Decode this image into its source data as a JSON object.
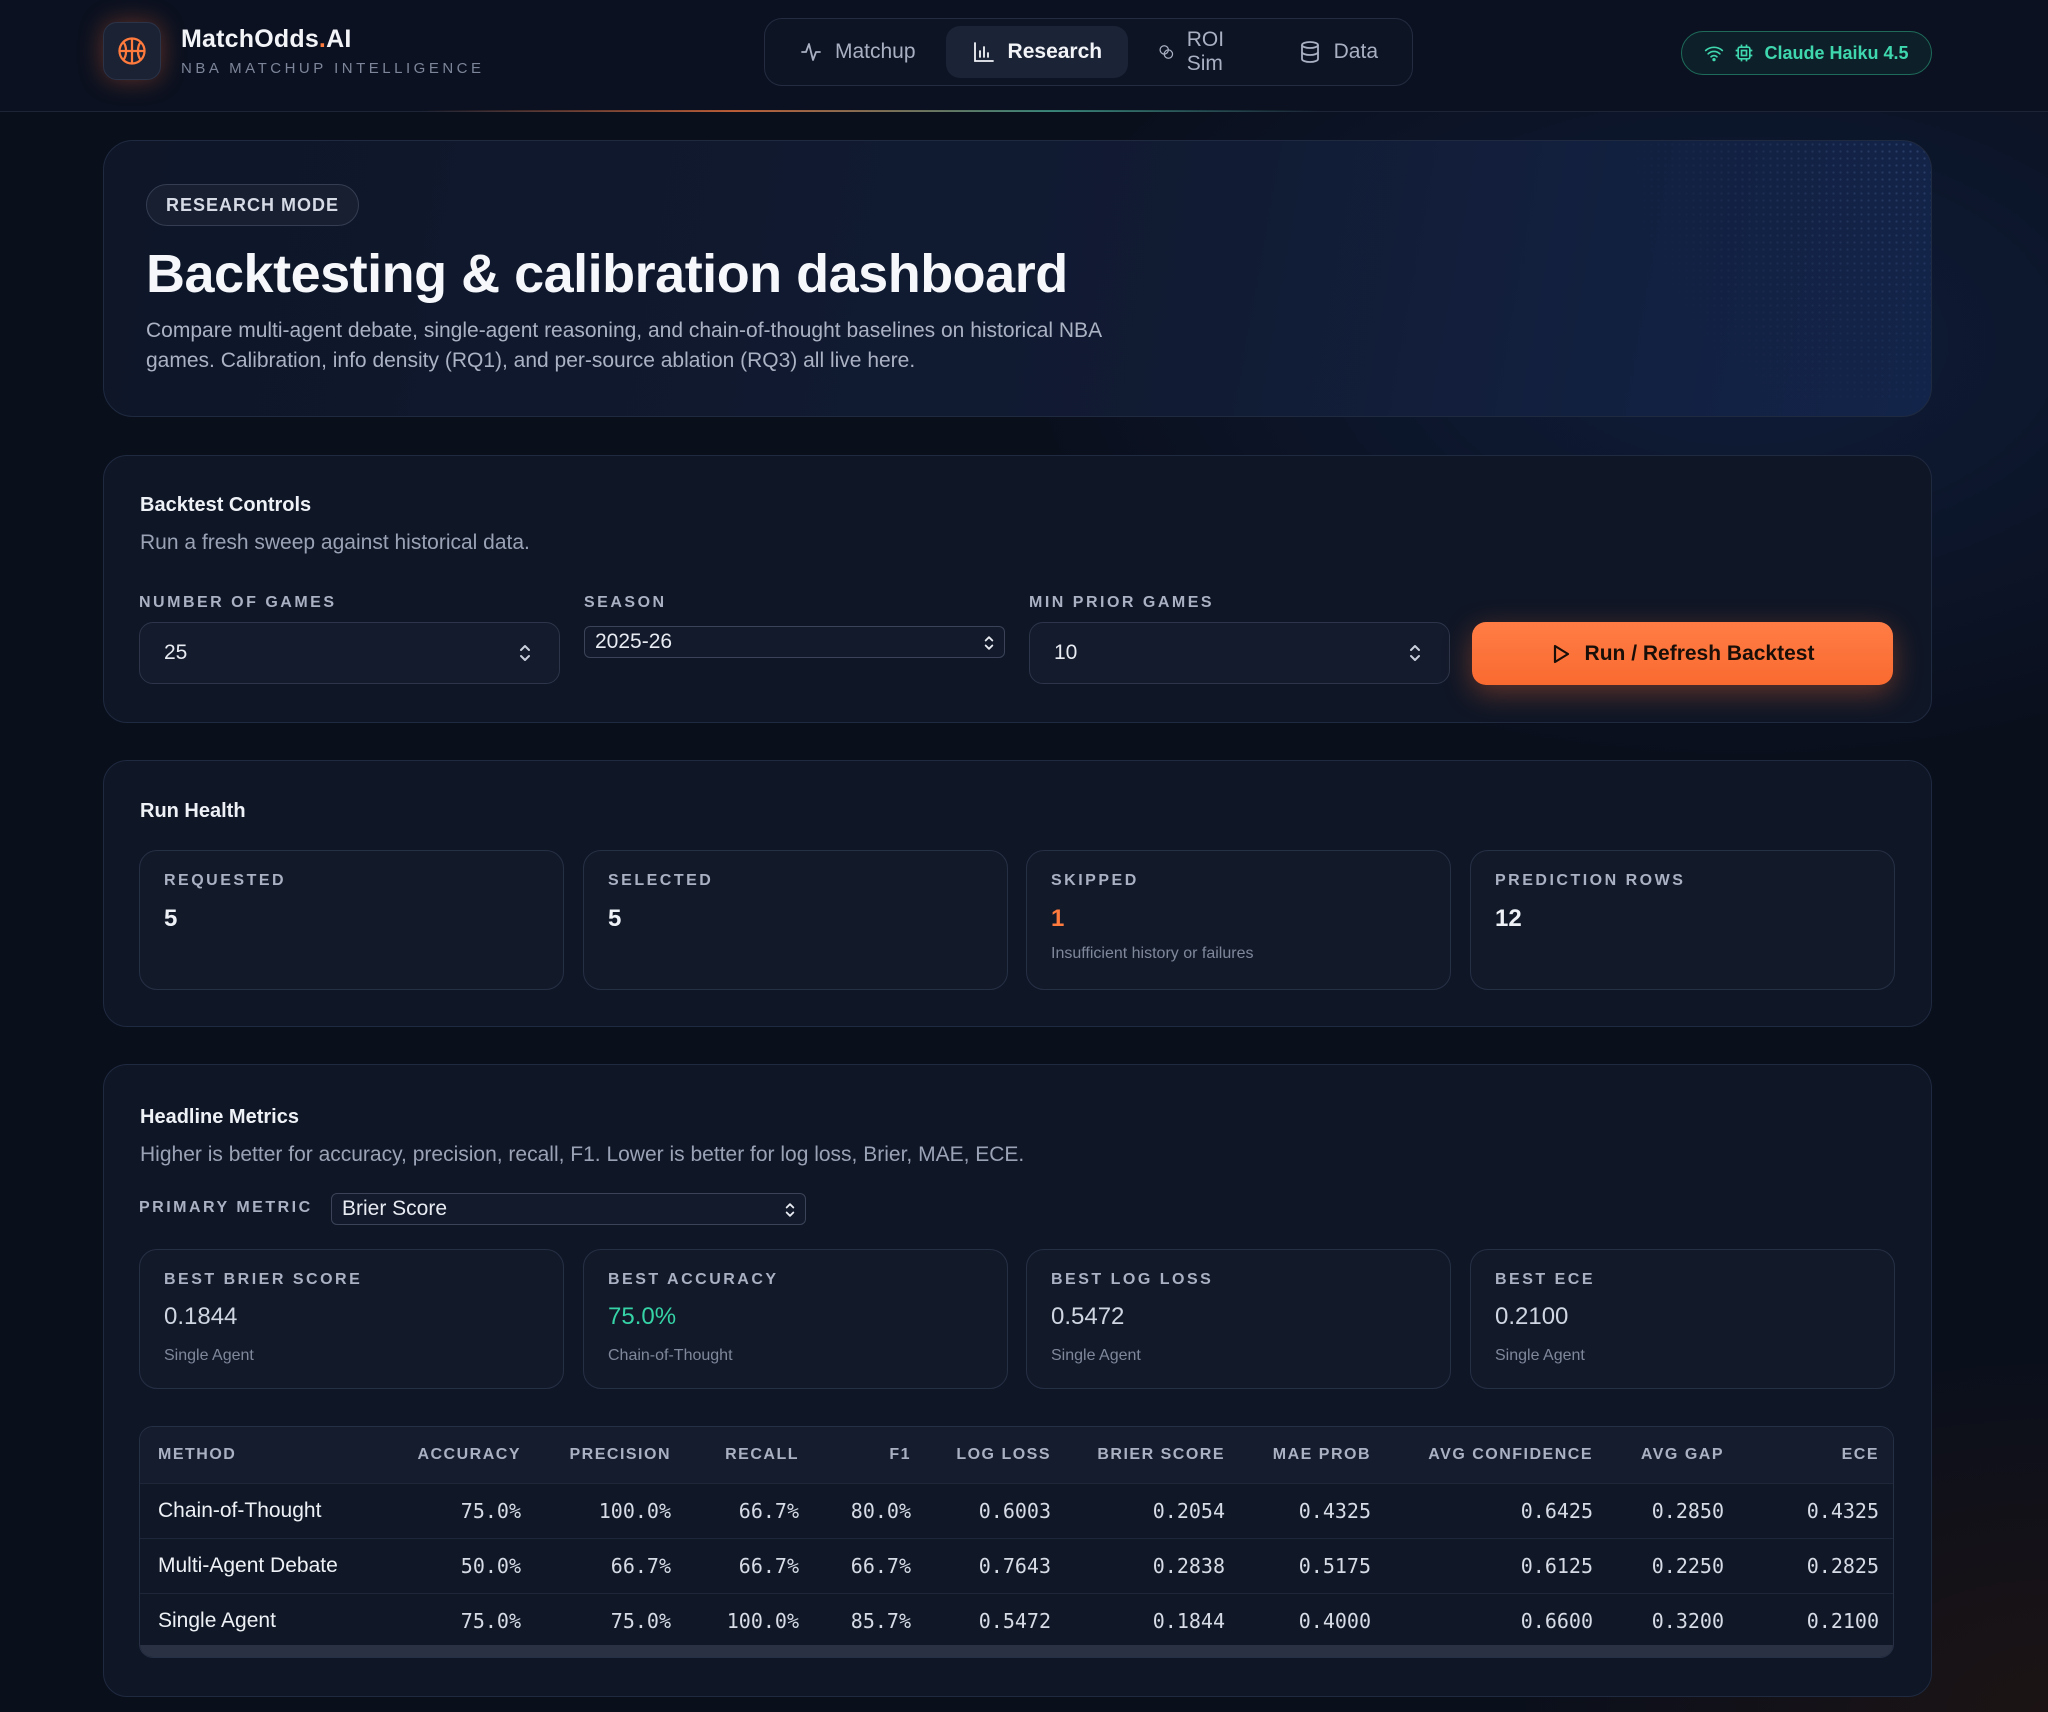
{
  "brand": {
    "name_main": "MatchOdds",
    "name_dot": ".",
    "name_suffix": "AI",
    "subtitle": "NBA MATCHUP INTELLIGENCE"
  },
  "nav": [
    {
      "label": "Matchup",
      "icon": "activity-icon",
      "active": false
    },
    {
      "label": "Research",
      "icon": "bar-chart-icon",
      "active": true
    },
    {
      "label": "ROI Sim",
      "icon": "coins-icon",
      "active": false
    },
    {
      "label": "Data",
      "icon": "database-icon",
      "active": false
    }
  ],
  "model": {
    "label": "Claude Haiku 4.5",
    "color": "#3fd7ad"
  },
  "hero": {
    "badge": "RESEARCH MODE",
    "title": "Backtesting & calibration dashboard",
    "description": "Compare multi-agent debate, single-agent reasoning, and chain-of-thought baselines on historical NBA games. Calibration, info density (RQ1), and per-source ablation (RQ3) all live here."
  },
  "controls": {
    "title": "Backtest Controls",
    "subtitle": "Run a fresh sweep against historical data.",
    "num_games_label": "NUMBER OF GAMES",
    "num_games_value": "25",
    "season_label": "SEASON",
    "season_value": "2025-26",
    "min_prior_label": "MIN PRIOR GAMES",
    "min_prior_value": "10",
    "run_button": "Run / Refresh Backtest",
    "accent": "#ff7a3d"
  },
  "health": {
    "title": "Run Health",
    "stats": [
      {
        "label": "REQUESTED",
        "value": "5",
        "note": ""
      },
      {
        "label": "SELECTED",
        "value": "5",
        "note": ""
      },
      {
        "label": "SKIPPED",
        "value": "1",
        "note": "Insufficient history or failures",
        "color": "#ff7a3d"
      },
      {
        "label": "PREDICTION ROWS",
        "value": "12",
        "note": ""
      }
    ]
  },
  "metrics": {
    "title": "Headline Metrics",
    "subtitle": "Higher is better for accuracy, precision, recall, F1. Lower is better for log loss, Brier, MAE, ECE.",
    "primary_label": "PRIMARY METRIC",
    "primary_value": "Brier Score",
    "cards": [
      {
        "label": "BEST BRIER SCORE",
        "value": "0.1844",
        "note": "Single Agent"
      },
      {
        "label": "BEST ACCURACY",
        "value": "75.0%",
        "note": "Chain-of-Thought",
        "color": "#35d3a6"
      },
      {
        "label": "BEST LOG LOSS",
        "value": "0.5472",
        "note": "Single Agent"
      },
      {
        "label": "BEST ECE",
        "value": "0.2100",
        "note": "Single Agent"
      }
    ]
  },
  "table": {
    "headers": [
      "METHOD",
      "ACCURACY",
      "PRECISION",
      "RECALL",
      "F1",
      "LOG LOSS",
      "BRIER SCORE",
      "MAE PROB",
      "AVG CONFIDENCE",
      "AVG GAP",
      "ECE"
    ],
    "rows": [
      [
        "Chain-of-Thought",
        "75.0%",
        "100.0%",
        "66.7%",
        "80.0%",
        "0.6003",
        "0.2054",
        "0.4325",
        "0.6425",
        "0.2850",
        "0.4325"
      ],
      [
        "Multi-Agent Debate",
        "50.0%",
        "66.7%",
        "66.7%",
        "66.7%",
        "0.7643",
        "0.2838",
        "0.5175",
        "0.6125",
        "0.2250",
        "0.2825"
      ],
      [
        "Single Agent",
        "75.0%",
        "75.0%",
        "100.0%",
        "85.7%",
        "0.5472",
        "0.1844",
        "0.4000",
        "0.6600",
        "0.3200",
        "0.2100"
      ]
    ]
  }
}
